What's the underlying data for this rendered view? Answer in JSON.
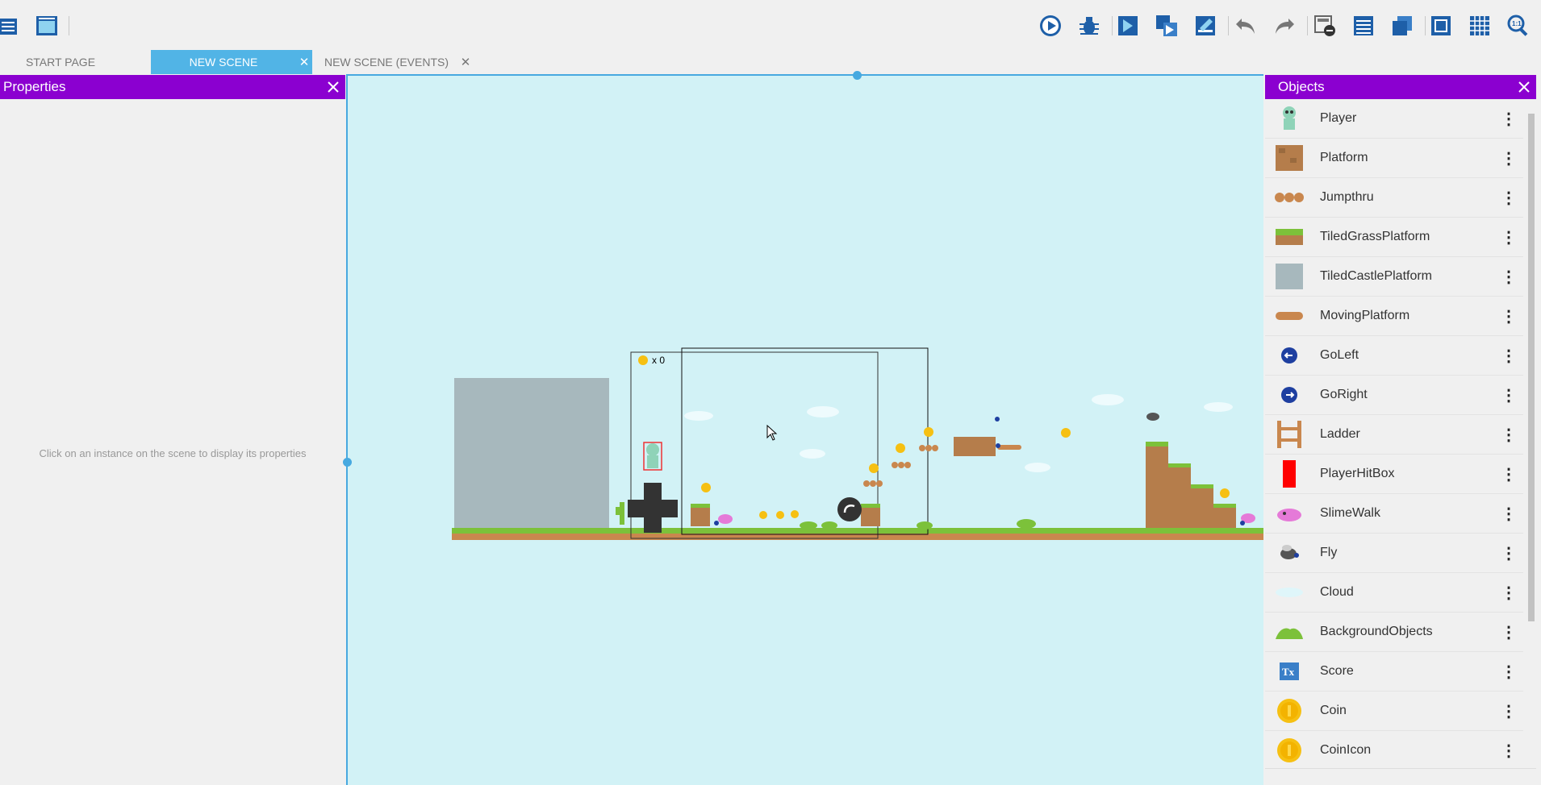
{
  "tabs": [
    {
      "label": "START PAGE"
    },
    {
      "label": "NEW SCENE",
      "active": true
    },
    {
      "label": "NEW SCENE (EVENTS)"
    }
  ],
  "properties": {
    "title": "Properties",
    "empty_message": "Click on an instance on the scene to display its properties"
  },
  "objects": {
    "title": "Objects",
    "items": [
      {
        "name": "Player",
        "icon": "player-icon"
      },
      {
        "name": "Platform",
        "icon": "platform-icon"
      },
      {
        "name": "Jumpthru",
        "icon": "jumpthru-icon"
      },
      {
        "name": "TiledGrassPlatform",
        "icon": "grass-platform-icon"
      },
      {
        "name": "TiledCastlePlatform",
        "icon": "castle-platform-icon"
      },
      {
        "name": "MovingPlatform",
        "icon": "moving-platform-icon"
      },
      {
        "name": "GoLeft",
        "icon": "go-left-icon"
      },
      {
        "name": "GoRight",
        "icon": "go-right-icon"
      },
      {
        "name": "Ladder",
        "icon": "ladder-icon"
      },
      {
        "name": "PlayerHitBox",
        "icon": "hitbox-icon"
      },
      {
        "name": "SlimeWalk",
        "icon": "slime-icon"
      },
      {
        "name": "Fly",
        "icon": "fly-icon"
      },
      {
        "name": "Cloud",
        "icon": "cloud-icon"
      },
      {
        "name": "BackgroundObjects",
        "icon": "bush-icon"
      },
      {
        "name": "Score",
        "icon": "text-object-icon"
      },
      {
        "name": "Coin",
        "icon": "coin-icon"
      },
      {
        "name": "CoinIcon",
        "icon": "coin-icon"
      }
    ]
  },
  "scene": {
    "score_text": "x 0"
  },
  "colors": {
    "accent": "#8b00d0",
    "tab_active": "#51b4e6",
    "scene_bg": "#d2f2f6",
    "selection": "#47a9e0"
  }
}
